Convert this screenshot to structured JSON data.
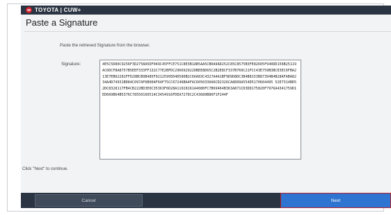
{
  "app": {
    "brand": "TOYOTA | CUW+",
    "logo_icon": "toyota-logo-icon",
    "colors": {
      "title_bar": "#2b3442",
      "logo_red": "#d0202e",
      "primary_button": "#2f74d0",
      "focus_border": "#b8222e",
      "secondary_button": "#3f4a5a"
    }
  },
  "page": {
    "title": "Paste a Signature",
    "instruction": "Paste the retrieved Signature from the browser.",
    "signature_label": "Signature:",
    "signature_value": "4E5C5D80C9256F3D2758A5DF049C45FFCE751C8E3B1AB5AA5CB0A9AD252C85C8575B3FE82605F940DD156B25119AC6DCF8A8757B5EEF333FF132C77E2BFDC296692922DBEE8D65C2B2E8CF337B760C21FCC43E759B3BCE3EC6FBA213E7EB02281FFD28BCB9B485F92125995D4D580B2C66A83C4327A4A1BF9D9D8DC3B4B8153B87394B4B28AFABA8234A4D74931BD84C097AF6B00AF64F75CC67246BA4FAC6050330A6CD2326CA8899A554D5170604495 52E7314BD52DC8328117FB4CB222BD3E0C35363F6D28A11028161A4080FC7B69464B363A871CD3DD175820F7976A4341759D1ED669B64B5376C78550160514C3454916FDEA727DC2C43689B86F1F244F",
    "continue_hint": "Click \"Next\" to continue."
  },
  "buttons": {
    "cancel": "Cancel",
    "next": "Next"
  }
}
